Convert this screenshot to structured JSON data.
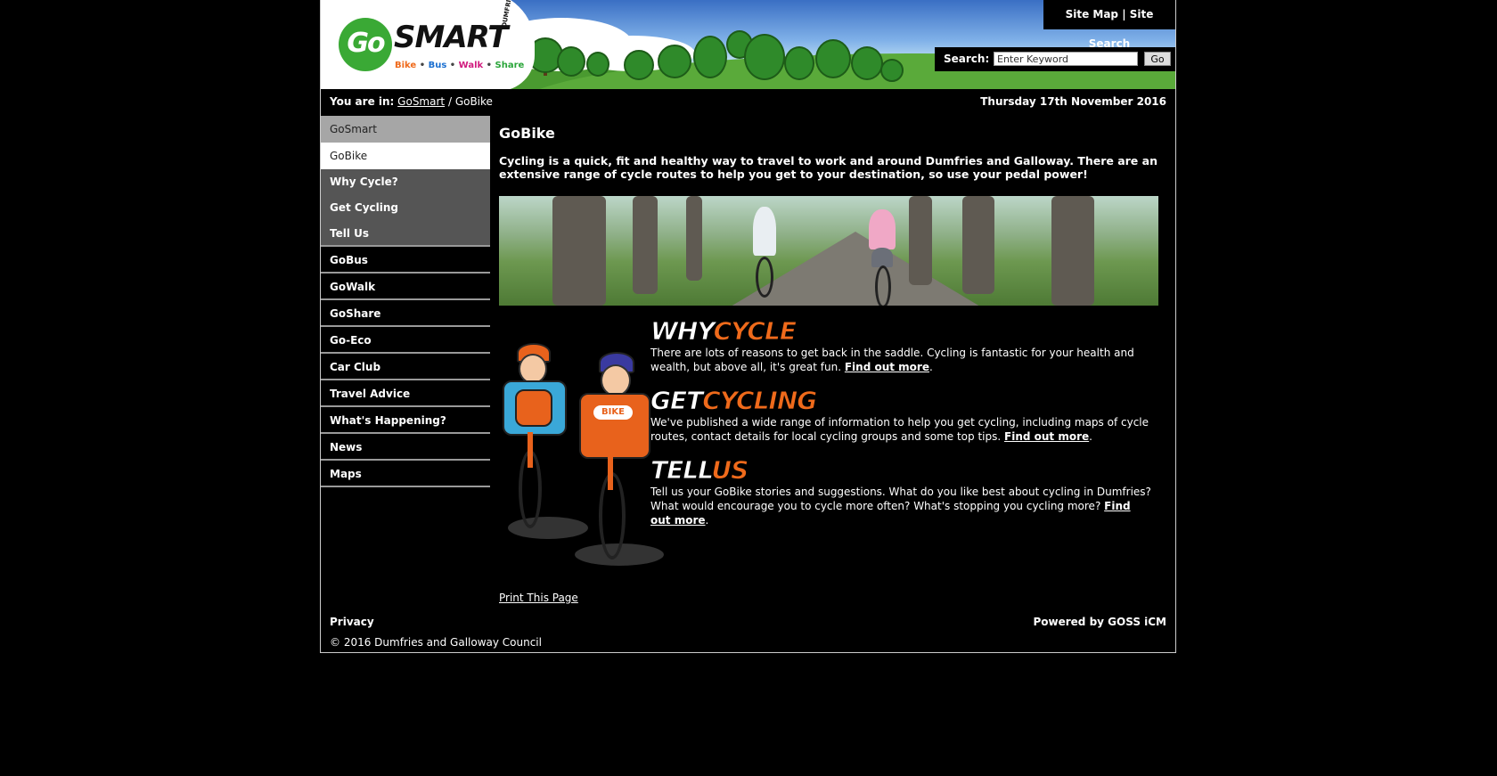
{
  "header": {
    "logo_go": "Go",
    "logo_smart": "SMART",
    "logo_dumfries": "DUMFRIES",
    "logo_tagline": [
      "Bike",
      "Bus",
      "Walk",
      "Share"
    ],
    "top_links": [
      "Site Map",
      "Site Search"
    ],
    "search_label": "Search:",
    "search_placeholder": "Enter Keyword",
    "search_button": "Go"
  },
  "breadcrumb": {
    "prefix": "You are in:",
    "items": [
      "GoSmart",
      "GoBike"
    ],
    "date": "Thursday 17th November 2016"
  },
  "sidebar": {
    "items": [
      {
        "label": "GoSmart"
      },
      {
        "label": "GoBike"
      },
      {
        "label": "Why Cycle?"
      },
      {
        "label": "Get Cycling"
      },
      {
        "label": "Tell Us"
      },
      {
        "label": "GoBus"
      },
      {
        "label": "GoWalk"
      },
      {
        "label": "GoShare"
      },
      {
        "label": "Go-Eco"
      },
      {
        "label": "Car Club"
      },
      {
        "label": "Travel Advice"
      },
      {
        "label": "What's Happening?"
      },
      {
        "label": "News"
      },
      {
        "label": "Maps"
      }
    ]
  },
  "main": {
    "title": "GoBike",
    "intro": "Cycling is a quick, fit and healthy way to travel to work and around Dumfries and Galloway. There are an extensive range of cycle routes to help you get to your destination, so use your pedal power!",
    "sections": [
      {
        "title_white": "WHY",
        "title_orange": "CYCLE",
        "text": "There are lots of reasons to get back in the saddle. Cycling is fantastic for your health and wealth, but above all, it's great fun.",
        "link": "Find out more",
        "end": "."
      },
      {
        "title_white": "GET",
        "title_orange": "CYCLING",
        "text": "We've published a wide range of information to help you get cycling, including maps of cycle routes, contact details for local cycling groups and some top tips.",
        "link": "Find out more",
        "end": "."
      },
      {
        "title_white": "TELL",
        "title_orange": "US",
        "text": "Tell us your GoBike stories and suggestions. What do you like best about cycling in Dumfries? What would encourage you to cycle more often? What's stopping you cycling more?",
        "link": "Find out more",
        "end": "."
      }
    ],
    "cartoon_badge": "BIKE",
    "print_link": "Print This Page"
  },
  "footer": {
    "privacy": "Privacy",
    "powered": "Powered by GOSS iCM",
    "copyright": "© 2016 Dumfries and Galloway Council"
  }
}
